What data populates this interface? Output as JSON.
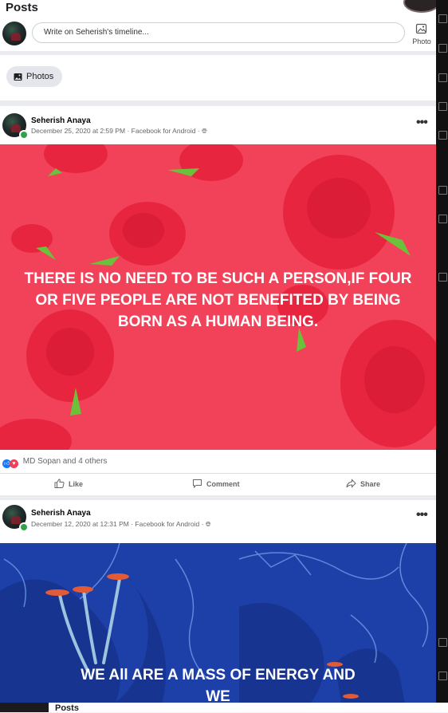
{
  "header": {
    "title": "Posts"
  },
  "composer": {
    "placeholder": "Write on Seherish's timeline...",
    "photo_label": "Photo"
  },
  "filters": {
    "photos_label": "Photos"
  },
  "posts": [
    {
      "author": "Seherish Anaya",
      "meta": "December 25, 2020 at 2:59 PM · Facebook for Android · ",
      "image_text": "THERE IS NO NEED TO BE SUCH A PERSON,IF FOUR OR FIVE PEOPLE ARE NOT BENEFITED BY BEING BORN AS A HUMAN BEING.",
      "image_bg": "#f2425a",
      "reactions": "MD Sopan and 4 others",
      "actions": {
        "like": "Like",
        "comment": "Comment",
        "share": "Share"
      }
    },
    {
      "author": "Seherish Anaya",
      "meta": "December 12, 2020 at 12:31 PM · Facebook for Android · ",
      "image_text": "WE All ARE A MASS OF ENERGY AND WE",
      "image_bg": "#1d3fa8"
    }
  ],
  "bottom_tab": {
    "title": "Posts"
  },
  "colors": {
    "like_blue": "#1877f2",
    "love_red": "#f33e58",
    "online_green": "#31a24c"
  }
}
